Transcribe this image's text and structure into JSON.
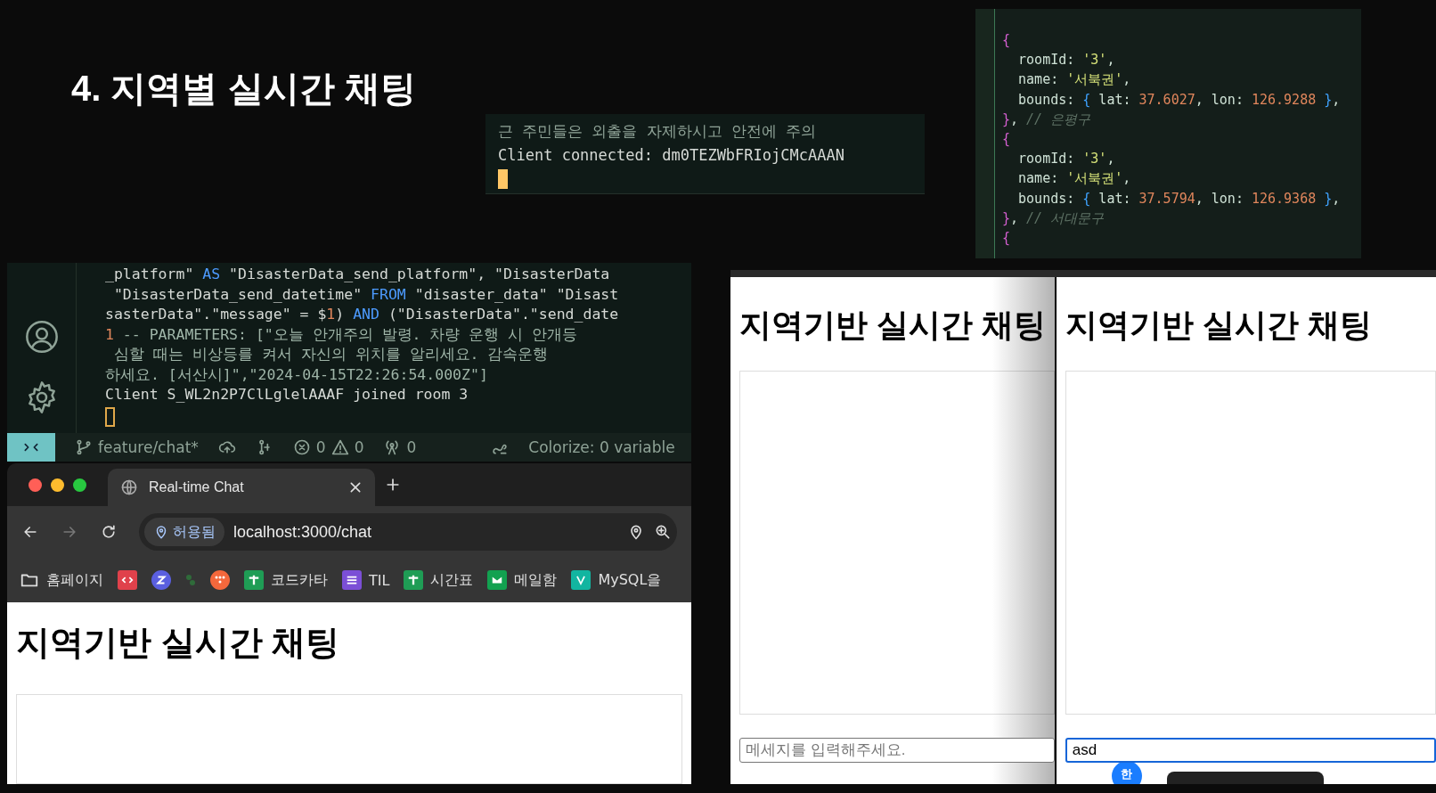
{
  "slide_title": "4. 지역별 실시간 채팅",
  "terminal_snippet": {
    "lines": [
      "근 주민들은 외출을 자제하시고 안전에 주의",
      "Client connected: dm0TEZWbFRIojCMcAAAN"
    ],
    "cursor_focused": true
  },
  "code_editor": {
    "lines": [
      [
        {
          "text": "{",
          "kind": "brace"
        }
      ],
      [
        {
          "text": "  roomId: ",
          "kind": "key"
        },
        {
          "text": "'3'",
          "kind": "string"
        },
        {
          "text": ",",
          "kind": "plain"
        }
      ],
      [
        {
          "text": "  name: ",
          "kind": "key"
        },
        {
          "text": "'서북권'",
          "kind": "string"
        },
        {
          "text": ",",
          "kind": "plain"
        }
      ],
      [
        {
          "text": "  bounds: ",
          "kind": "key"
        },
        {
          "text": "{",
          "kind": "bracket"
        },
        {
          "text": " lat: ",
          "kind": "key"
        },
        {
          "text": "37.6027",
          "kind": "number"
        },
        {
          "text": ", lon: ",
          "kind": "key"
        },
        {
          "text": "126.9288",
          "kind": "number"
        },
        {
          "text": " }",
          "kind": "bracket"
        },
        {
          "text": ",",
          "kind": "plain"
        }
      ],
      [
        {
          "text": "}",
          "kind": "brace"
        },
        {
          "text": ", ",
          "kind": "plain"
        },
        {
          "text": "// 은평구",
          "kind": "comment"
        }
      ],
      [
        {
          "text": "{",
          "kind": "brace"
        }
      ],
      [
        {
          "text": "  roomId: ",
          "kind": "key"
        },
        {
          "text": "'3'",
          "kind": "string"
        },
        {
          "text": ",",
          "kind": "plain"
        }
      ],
      [
        {
          "text": "  name: ",
          "kind": "key"
        },
        {
          "text": "'서북권'",
          "kind": "string"
        },
        {
          "text": ",",
          "kind": "plain"
        }
      ],
      [
        {
          "text": "  bounds: ",
          "kind": "key"
        },
        {
          "text": "{",
          "kind": "bracket"
        },
        {
          "text": " lat: ",
          "kind": "key"
        },
        {
          "text": "37.5794",
          "kind": "number"
        },
        {
          "text": ", lon: ",
          "kind": "key"
        },
        {
          "text": "126.9368",
          "kind": "number"
        },
        {
          "text": " }",
          "kind": "bracket"
        },
        {
          "text": ",",
          "kind": "plain"
        }
      ],
      [
        {
          "text": "}",
          "kind": "brace"
        },
        {
          "text": ", ",
          "kind": "plain"
        },
        {
          "text": "// 서대문구",
          "kind": "comment"
        }
      ],
      [
        {
          "text": "{",
          "kind": "brace"
        }
      ]
    ]
  },
  "ide_terminal": {
    "lines": [
      [
        {
          "text": "_platform\" ",
          "kind": "plain"
        },
        {
          "text": "AS",
          "kind": "keyword"
        },
        {
          "text": " \"DisasterData_send_platform\", \"DisasterData",
          "kind": "plain"
        }
      ],
      [
        {
          "text": " \"DisasterData_send_datetime\" ",
          "kind": "plain"
        },
        {
          "text": "FROM",
          "kind": "keyword"
        },
        {
          "text": " \"disaster_data\" \"Disast",
          "kind": "plain"
        }
      ],
      [
        {
          "text": "sasterData\".\"message\" = $",
          "kind": "plain"
        },
        {
          "text": "1",
          "kind": "number"
        },
        {
          "text": ") ",
          "kind": "plain"
        },
        {
          "text": "AND",
          "kind": "keyword"
        },
        {
          "text": " (\"DisasterData\".\"send_date",
          "kind": "plain"
        }
      ],
      [
        {
          "text": "1",
          "kind": "number"
        },
        {
          "text": " -- PARAMETERS: [\"오늘 안개주의 발령. 차량 운행 시 안개등",
          "kind": "dim"
        }
      ],
      [
        {
          "text": " 심할 때는 비상등를 켜서 자신의 위치를 알리세요. 감속운행",
          "kind": "dim"
        }
      ],
      [
        {
          "text": "하세요. [서산시]\",\"2024-04-15T22:26:54.000Z\"]",
          "kind": "dim"
        }
      ],
      [
        {
          "text": "Client S_WL2n2P7ClLglelAAAF joined room 3",
          "kind": "plain"
        }
      ]
    ],
    "cursor_focused": false,
    "status_bar": {
      "branch": "feature/chat*",
      "errors": "0",
      "warnings": "0",
      "ports": "0",
      "colorize": "Colorize: 0 variable"
    }
  },
  "browser": {
    "tab_title": "Real-time Chat",
    "site_chip": "허용됨",
    "url": "localhost:3000/chat",
    "bookmarks": [
      {
        "label": "홈페이지",
        "kind": "folder"
      },
      {
        "kind": "code",
        "color": "#e0414b"
      },
      {
        "kind": "letter",
        "color": "#5a5fe0"
      },
      {
        "kind": "sprout",
        "color": "#2f6b3a"
      },
      {
        "kind": "dots",
        "color": "#f4683c"
      },
      {
        "label": "코드카타",
        "kind": "plus",
        "color": "#1f9d55"
      },
      {
        "label": "TIL",
        "kind": "list",
        "color": "#7b4fd6"
      },
      {
        "label": "시간표",
        "kind": "plus",
        "color": "#1f9d55"
      },
      {
        "label": "메일함",
        "kind": "mail",
        "color": "#12a150"
      },
      {
        "label": "MySQL을",
        "kind": "v",
        "color": "#12b5a0"
      }
    ],
    "page_heading": "지역기반 실시간 채팅"
  },
  "chat_panes": [
    {
      "heading": "지역기반 실시간 채팅",
      "input": {
        "placeholder": "메세지를 입력해주세요.",
        "focused": false
      }
    },
    {
      "heading": "지역기반 실시간 채팅",
      "input": {
        "value": "asd",
        "focused": true
      },
      "ime_badge": "한",
      "tooltip": true
    }
  ]
}
